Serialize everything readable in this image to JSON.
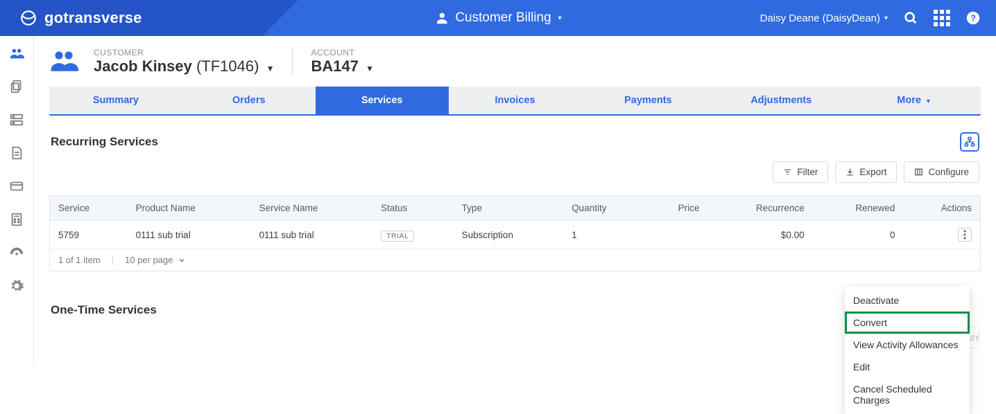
{
  "brand": {
    "name": "gotransverse"
  },
  "header": {
    "module": "Customer Billing",
    "user_display": "Daisy Deane (DaisyDean)"
  },
  "customer": {
    "label": "CUSTOMER",
    "name": "Jacob Kinsey",
    "code": "(TF1046)"
  },
  "account": {
    "label": "ACCOUNT",
    "number": "BA147"
  },
  "tabs": {
    "summary": "Summary",
    "orders": "Orders",
    "services": "Services",
    "invoices": "Invoices",
    "payments": "Payments",
    "adjustments": "Adjustments",
    "more": "More"
  },
  "sections": {
    "recurring": "Recurring Services",
    "onetime": "One-Time Services"
  },
  "toolbar": {
    "filter": "Filter",
    "export": "Export",
    "configure": "Configure"
  },
  "table": {
    "headers": {
      "service": "Service",
      "product": "Product Name",
      "sname": "Service Name",
      "status": "Status",
      "type": "Type",
      "qty": "Quantity",
      "price": "Price",
      "recur": "Recurrence",
      "renewed": "Renewed",
      "actions": "Actions"
    },
    "rows": [
      {
        "service": "5759",
        "product": "0111 sub trial",
        "sname": "0111 sub trial",
        "status": "TRIAL",
        "type": "Subscription",
        "qty": "1",
        "price": "",
        "recur": "$0.00",
        "renewed": "0"
      }
    ],
    "pager": {
      "count": "1 of 1 item",
      "perpage": "10 per page"
    }
  },
  "actions_menu": {
    "deactivate": "Deactivate",
    "convert": "Convert",
    "view_allow": "View Activity Allowances",
    "edit": "Edit",
    "cancel_sched": "Cancel Scheduled Charges"
  }
}
